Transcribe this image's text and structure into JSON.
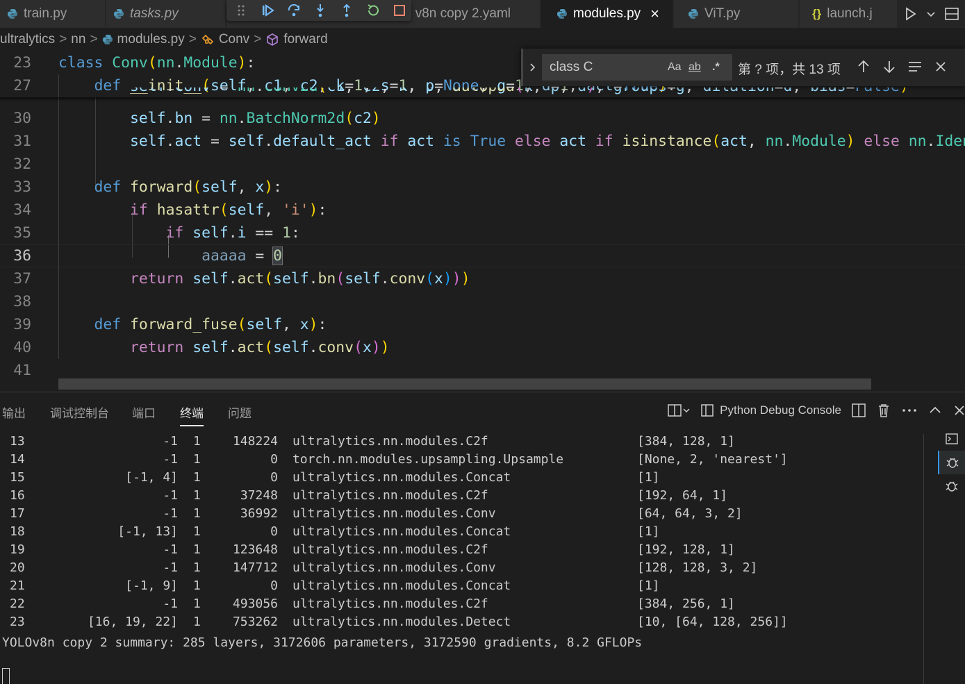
{
  "tabs": [
    {
      "label": "train.py",
      "icon": "python-icon"
    },
    {
      "label": "tasks.py",
      "icon": "python-icon",
      "italic": true
    },
    {
      "label": "v8n copy 2.yaml",
      "icon": "yaml-icon"
    },
    {
      "label": "modules.py",
      "icon": "python-icon",
      "active": true
    },
    {
      "label": "ViT.py",
      "icon": "python-icon"
    },
    {
      "label": "launch.j",
      "icon": "json-icon"
    }
  ],
  "json_icon_glyph": "{}",
  "close_glyph": "×",
  "breadcrumb": {
    "items": [
      "ultralytics",
      "nn",
      "modules.py",
      "Conv",
      "forward"
    ],
    "separator": ">"
  },
  "find": {
    "value": "class C",
    "opt_case": "Aa",
    "opt_word": "ab",
    "opt_regex": ".*",
    "count": "第 ? 项，共 13 项"
  },
  "editor": {
    "line_numbers": [
      "23",
      "27",
      "30",
      "31",
      "32",
      "33",
      "34",
      "35",
      "36",
      "37",
      "38",
      "39",
      "40",
      "41"
    ],
    "current_line": "36"
  },
  "panel": {
    "tabs": [
      "输出",
      "调试控制台",
      "端口",
      "终端",
      "问题"
    ],
    "active_tab": "终端",
    "terminal_name": "Python Debug Console"
  },
  "terminal": {
    "rows": [
      {
        "idx": "13",
        "from": "-1",
        "n": "1",
        "params": "148224",
        "module": "ultralytics.nn.modules.C2f",
        "args": "[384, 128, 1]"
      },
      {
        "idx": "14",
        "from": "-1",
        "n": "1",
        "params": "0",
        "module": "torch.nn.modules.upsampling.Upsample",
        "args": "[None, 2, 'nearest']"
      },
      {
        "idx": "15",
        "from": "[-1, 4]",
        "n": "1",
        "params": "0",
        "module": "ultralytics.nn.modules.Concat",
        "args": "[1]"
      },
      {
        "idx": "16",
        "from": "-1",
        "n": "1",
        "params": "37248",
        "module": "ultralytics.nn.modules.C2f",
        "args": "[192, 64, 1]"
      },
      {
        "idx": "17",
        "from": "-1",
        "n": "1",
        "params": "36992",
        "module": "ultralytics.nn.modules.Conv",
        "args": "[64, 64, 3, 2]"
      },
      {
        "idx": "18",
        "from": "[-1, 13]",
        "n": "1",
        "params": "0",
        "module": "ultralytics.nn.modules.Concat",
        "args": "[1]"
      },
      {
        "idx": "19",
        "from": "-1",
        "n": "1",
        "params": "123648",
        "module": "ultralytics.nn.modules.C2f",
        "args": "[192, 128, 1]"
      },
      {
        "idx": "20",
        "from": "-1",
        "n": "1",
        "params": "147712",
        "module": "ultralytics.nn.modules.Conv",
        "args": "[128, 128, 3, 2]"
      },
      {
        "idx": "21",
        "from": "[-1, 9]",
        "n": "1",
        "params": "0",
        "module": "ultralytics.nn.modules.Concat",
        "args": "[1]"
      },
      {
        "idx": "22",
        "from": "-1",
        "n": "1",
        "params": "493056",
        "module": "ultralytics.nn.modules.C2f",
        "args": "[384, 256, 1]"
      },
      {
        "idx": "23",
        "from": "[16, 19, 22]",
        "n": "1",
        "params": "753262",
        "module": "ultralytics.nn.modules.Detect",
        "args": "[10, [64, 128, 256]]"
      }
    ],
    "summary": "YOLOv8n copy 2 summary: 285 layers, 3172606 parameters, 3172590 gradients, 8.2 GFLOPs"
  },
  "colors": {
    "keyword": "#569cd6",
    "control": "#c586c0",
    "class": "#4ec9b0",
    "function": "#dcdcaa",
    "param": "#9cdcfe",
    "number": "#b5cea8",
    "string": "#ce9178",
    "accent": "#3794ff"
  }
}
